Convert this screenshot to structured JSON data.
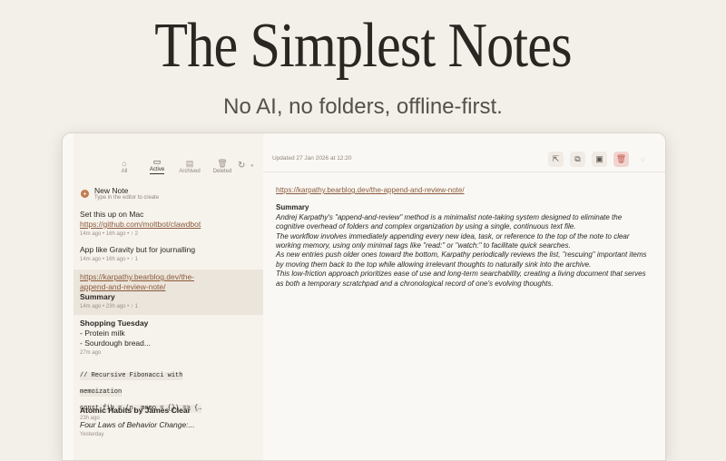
{
  "hero": {
    "title": "The Simplest Notes",
    "subtitle": "No AI, no folders, offline-first."
  },
  "sidebar": {
    "filters": [
      {
        "label": "All",
        "icon": "box-icon"
      },
      {
        "label": "Active",
        "icon": "inbox-icon"
      },
      {
        "label": "Archived",
        "icon": "archive-icon"
      },
      {
        "label": "Deleted",
        "icon": "trash-icon"
      }
    ],
    "new_note": {
      "title": "New Note",
      "hint": "Type in the editor to create"
    },
    "notes": [
      {
        "lines": [
          "Set this up on Mac",
          "https://github.com/moltbot/clawdbot"
        ],
        "meta": "14m ago • 16h ago • ↑ 2"
      },
      {
        "lines": [
          "App like Gravity but for journalling"
        ],
        "meta": "14m ago • 16h ago • ↑ 1"
      },
      {
        "lines": [
          "https://karpathy.bearblog.dev/the-",
          "append-and-review-note/",
          "Summary"
        ],
        "meta": "14m ago • 23h ago • ↑ 1"
      },
      {
        "lines": [
          "Shopping Tuesday",
          "- Protein milk",
          "- Sourdough bread..."
        ],
        "meta": "27m ago"
      },
      {
        "lines": [
          "// Recursive Fibonacci with",
          "memoization",
          "const fib = (n, memo = {}) => {…"
        ],
        "meta": "23h ago"
      },
      {
        "lines": [
          "Atomic Habits by James Clear",
          "Four Laws of Behavior Change:..."
        ],
        "meta": "Yesterday"
      }
    ]
  },
  "editor": {
    "updated": "Updated 27 Jan 2026 at 12:20",
    "url": "https://karpathy.bearblog.dev/the-append-and-review-note/",
    "heading": "Summary",
    "paragraphs": [
      "Andrej Karpathy's \"append-and-review\" method is a minimalist note-taking system designed to eliminate the cognitive overhead of folders and complex organization by using a single, continuous text file.",
      "The workflow involves immediately appending every new idea, task, or reference to the top of the note to clear working memory, using only minimal tags like \"read:\" or \"watch:\" to facilitate quick searches.",
      "As new entries push older ones toward the bottom, Karpathy periodically reviews the list, \"rescuing\" important items by moving them back to the top while allowing irrelevant thoughts to naturally sink into the archive.",
      "This low-friction approach prioritizes ease of use and long-term searchability, creating a living document that serves as both a temporary scratchpad and a chronological record of one's evolving thoughts."
    ]
  },
  "colors": {
    "background": "#f3efe9",
    "accent": "#c07a4f",
    "link": "#8a5a3a",
    "delete": "#c25b4e"
  }
}
